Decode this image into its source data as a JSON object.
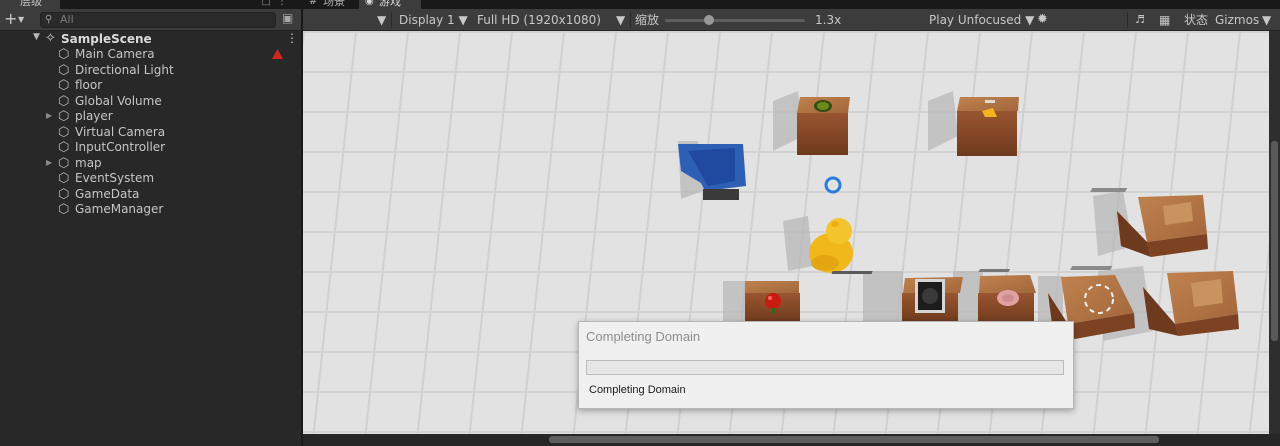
{
  "hierarchy": {
    "tab_label": "层级",
    "search_placeholder": "All",
    "scene_name": "SampleScene",
    "items": [
      {
        "label": "Main Camera",
        "expandable": false,
        "warning": true
      },
      {
        "label": "Directional Light",
        "expandable": false,
        "warning": false
      },
      {
        "label": "floor",
        "expandable": false,
        "warning": false
      },
      {
        "label": "Global Volume",
        "expandable": false,
        "warning": false
      },
      {
        "label": "player",
        "expandable": true,
        "warning": false
      },
      {
        "label": "Virtual Camera",
        "expandable": false,
        "warning": false
      },
      {
        "label": "InputController",
        "expandable": false,
        "warning": false
      },
      {
        "label": "map",
        "expandable": true,
        "warning": false
      },
      {
        "label": "EventSystem",
        "expandable": false,
        "warning": false
      },
      {
        "label": "GameData",
        "expandable": false,
        "warning": false
      },
      {
        "label": "GameManager",
        "expandable": false,
        "warning": false
      }
    ]
  },
  "tabs": {
    "scene": "场景",
    "game": "游戏"
  },
  "game_toolbar": {
    "display": "Display 1",
    "resolution": "Full HD (1920x1080)",
    "scale_label": "缩放",
    "scale_value": "1.3x",
    "play_mode": "Play Unfocused",
    "stats": "状态",
    "gizmos": "Gizmos"
  },
  "dialog": {
    "title": "Completing Domain",
    "info": "Completing Domain",
    "progress": 0
  },
  "colors": {
    "editor_bg": "#282828",
    "toolbar": "#3c3c3c",
    "floor_tile": "#e1e1e1",
    "crate": "#8a4a28",
    "trash_bin": "#2f63b8",
    "duck": "#f4c020"
  }
}
